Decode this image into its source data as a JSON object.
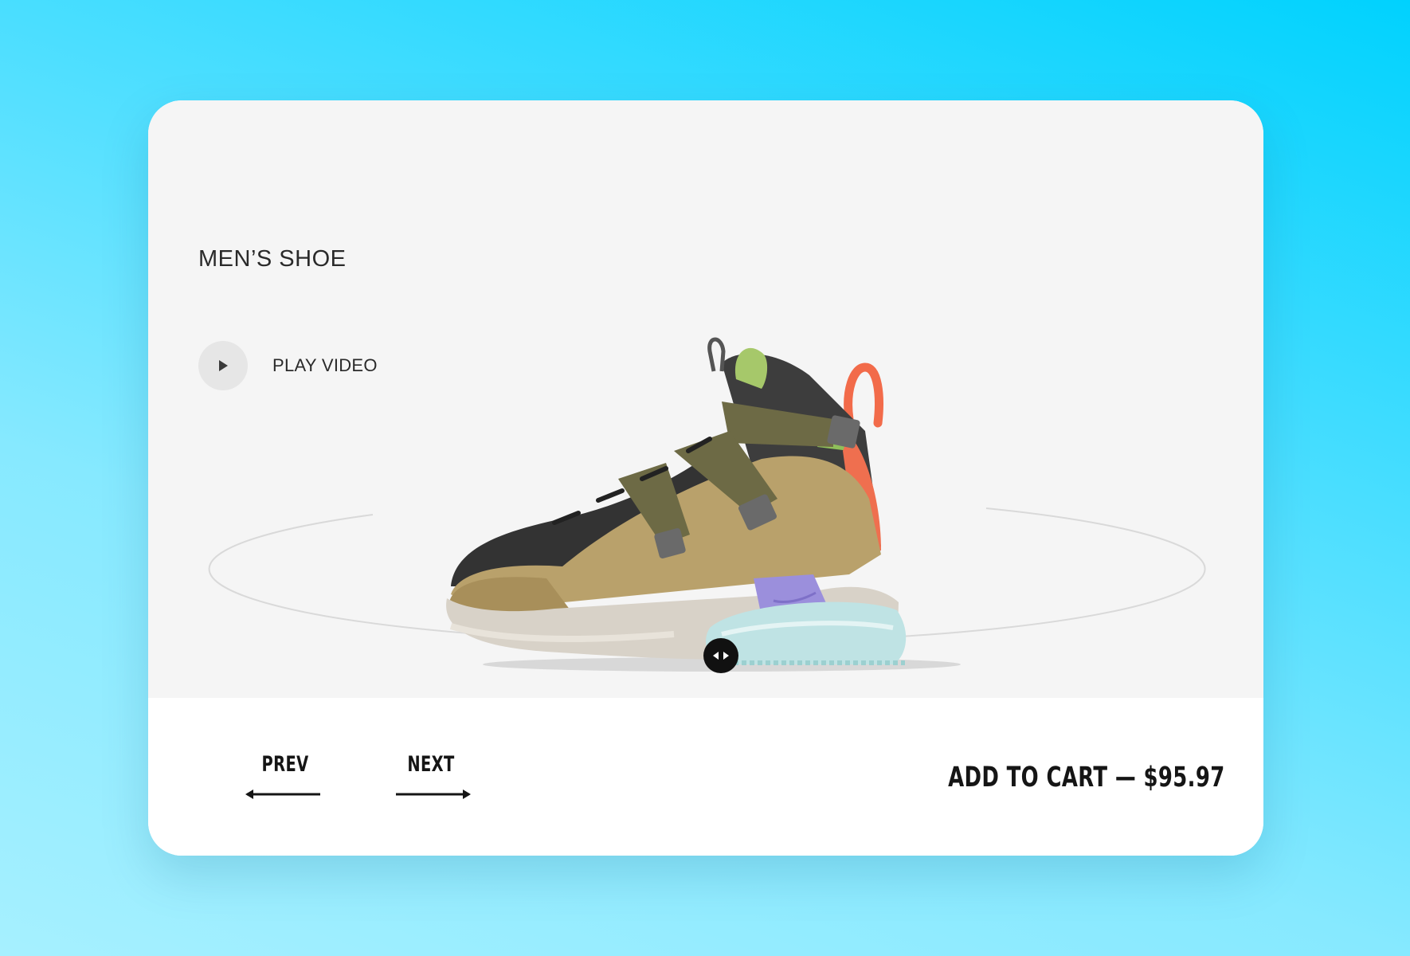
{
  "product": {
    "type_label": "MEN’S SHOE"
  },
  "video": {
    "label": "PLAY VIDEO",
    "icon": "play-icon"
  },
  "viewer": {
    "rotate_icon": "left-right-arrows-icon"
  },
  "nav": {
    "prev_label": "PREV",
    "next_label": "NEXT",
    "prev_icon": "arrow-left-icon",
    "next_icon": "arrow-right-icon"
  },
  "cart": {
    "label": "ADD TO CART — $95.97"
  },
  "colors": {
    "background_top": "#00d2fe",
    "background_bottom": "#a6f0ff",
    "stage": "#f5f5f5",
    "text_dark": "#151515"
  }
}
